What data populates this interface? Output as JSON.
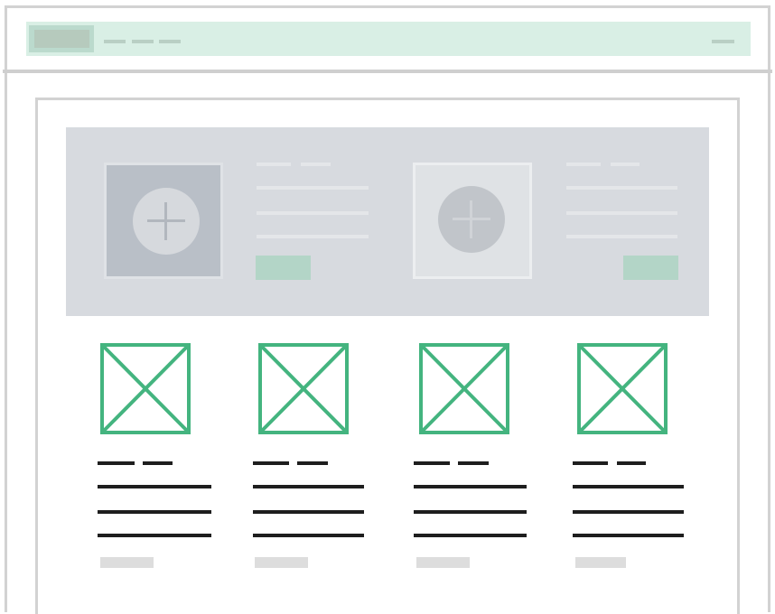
{
  "colors": {
    "frame": "#d2d2d2",
    "navbar_fill": "#d9efe5",
    "accent_green": "#44b47f",
    "accent_green_muted": "#b3d5c7",
    "hero_fill": "#d7dadf",
    "text_line": "#1e1e1e",
    "placeholder_gray": "#dddddd"
  },
  "navbar": {
    "logo_icon": "logo-placeholder",
    "links": [
      "nav-link-1",
      "nav-link-2",
      "nav-link-3"
    ],
    "right_item": "menu-link"
  },
  "hero": {
    "items": [
      {
        "image_icon": "add-image-icon",
        "button": "hero-button"
      },
      {
        "image_icon": "add-image-icon",
        "button": "hero-button"
      }
    ]
  },
  "products": {
    "cards": [
      {
        "image_icon": "image-placeholder-icon"
      },
      {
        "image_icon": "image-placeholder-icon"
      },
      {
        "image_icon": "image-placeholder-icon"
      },
      {
        "image_icon": "image-placeholder-icon"
      }
    ]
  }
}
